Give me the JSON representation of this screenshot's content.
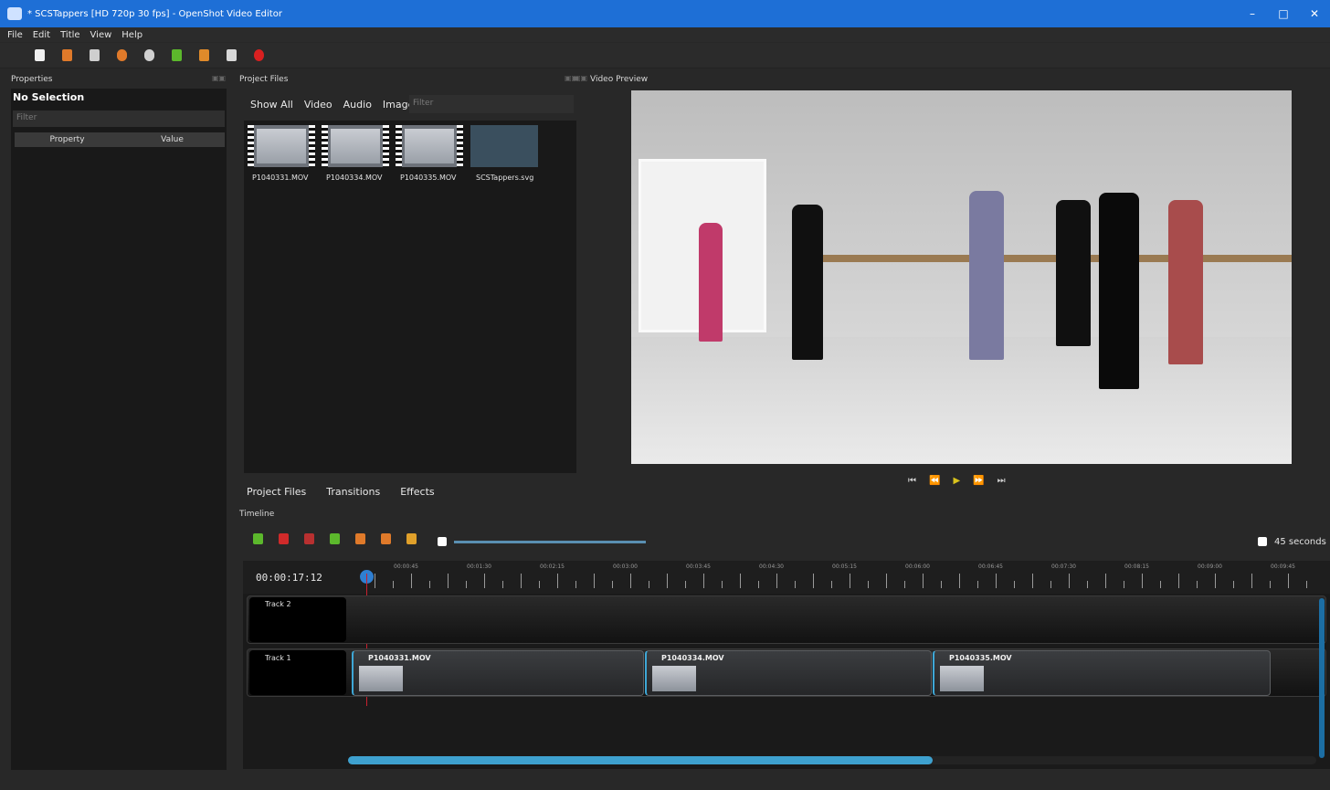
{
  "window": {
    "title": "* SCSTappers [HD 720p 30 fps] - OpenShot Video Editor",
    "minimize": "–",
    "maximize": "□",
    "close": "✕"
  },
  "menu": [
    "File",
    "Edit",
    "Title",
    "View",
    "Help"
  ],
  "toolbar_icons": [
    "new-project-icon",
    "open-project-icon",
    "save-project-icon",
    "undo-icon",
    "redo-icon",
    "import-files-icon",
    "profile-icon",
    "fullscreen-icon",
    "export-video-icon"
  ],
  "properties": {
    "dock_title": "Properties",
    "heading": "No Selection",
    "filter_placeholder": "Filter",
    "col_property": "Property",
    "col_value": "Value"
  },
  "project_files": {
    "dock_title": "Project Files",
    "tabs": [
      "Show All",
      "Video",
      "Audio",
      "Image"
    ],
    "filter_placeholder": "Filter",
    "files": [
      "P1040331.MOV",
      "P1040334.MOV",
      "P1040335.MOV",
      "SCSTappers.svg"
    ]
  },
  "video_preview": {
    "dock_title": "Video Preview"
  },
  "player": {
    "start": "⏮",
    "rewind": "⏪",
    "play": "▶",
    "fast_forward": "⏩",
    "end": "⏭"
  },
  "bottom_tabs": [
    "Project Files",
    "Transitions",
    "Effects"
  ],
  "timeline": {
    "dock_title": "Timeline",
    "timecode": "00:00:17:12",
    "zoom_label": "45 seconds",
    "ticks": [
      "00:00:45",
      "00:01:30",
      "00:02:15",
      "00:03:00",
      "00:03:45",
      "00:04:30",
      "00:05:15",
      "00:06:00",
      "00:06:45",
      "00:07:30",
      "00:08:15",
      "00:09:00",
      "00:09:45"
    ],
    "tracks": [
      {
        "name": "Track 2",
        "clips": []
      },
      {
        "name": "Track 1",
        "clips": [
          "P1040331.MOV",
          "P1040334.MOV",
          "P1040335.MOV"
        ]
      }
    ]
  },
  "colors": {
    "titlebar": "#1e6fd6",
    "accent": "#3ea7d6",
    "playhead": "#c8202e",
    "background": "#282828"
  }
}
